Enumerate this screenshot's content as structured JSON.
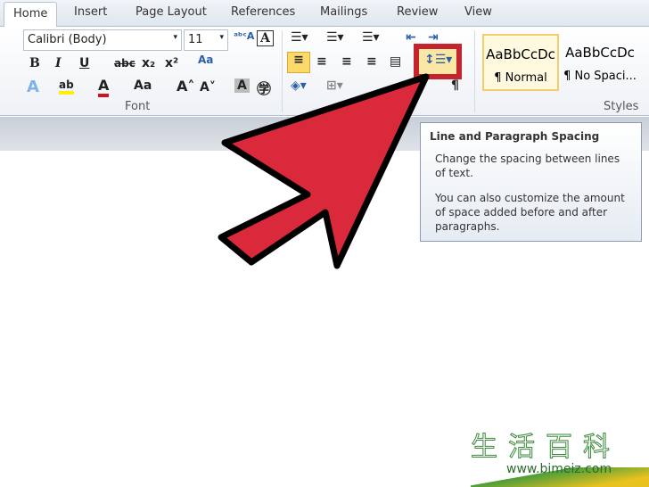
{
  "tabs": [
    "Home",
    "Insert",
    "Page Layout",
    "References",
    "Mailings",
    "Review",
    "View"
  ],
  "font": {
    "name": "Calibri (Body)",
    "size": "11",
    "group_label": "Font"
  },
  "paragraph": {
    "highlighted_button": "Line and Paragraph Spacing"
  },
  "styles": {
    "group_label": "Styles",
    "items": [
      {
        "sample": "AaBbCcDc",
        "name": "¶ Normal"
      },
      {
        "sample": "AaBbCcDc",
        "name": "¶ No Spaci..."
      }
    ]
  },
  "tooltip": {
    "title": "Line and Paragraph Spacing",
    "line1": "Change the spacing between lines of text.",
    "line2": "You can also customize the amount of space added before and after paragraphs."
  },
  "watermark": {
    "text": "生活百科",
    "url": "www.bimeiz.com"
  },
  "colors": {
    "arrow": "#d9293a",
    "highlight_box": "#c4242d",
    "selected": "#fbd96a"
  }
}
